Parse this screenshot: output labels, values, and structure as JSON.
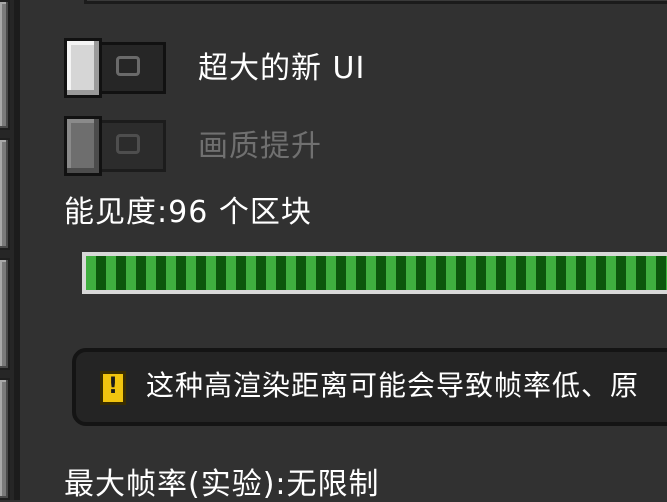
{
  "options": {
    "giant_ui": {
      "label": "超大的新 UI",
      "enabled": true
    },
    "graphics_upgrade": {
      "label": "画质提升",
      "enabled": false
    }
  },
  "render_distance": {
    "label": "能见度:96 个区块",
    "value": 96
  },
  "warning": {
    "icon": "exclamation-icon",
    "text": "这种高渲染距离可能会导致帧率低、原"
  },
  "max_framerate": {
    "label": "最大帧率(实验):无限制"
  },
  "colors": {
    "background": "#313131",
    "slider_fill": "#3fae3f",
    "slider_dark": "#0c560c",
    "warning_icon": "#f1c40f"
  }
}
